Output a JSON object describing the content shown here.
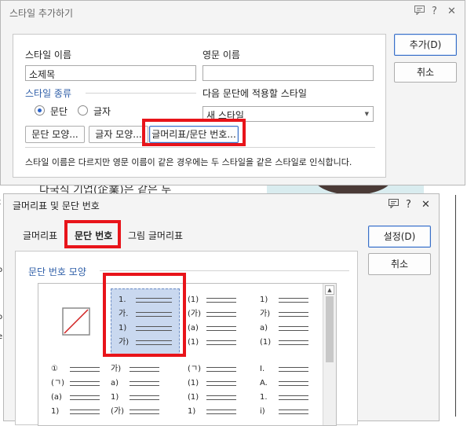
{
  "dialog1": {
    "title": "스타일 추가하기",
    "style_name_label": "스타일 이름",
    "style_name_value": "소제목",
    "english_name_label": "영문 이름",
    "english_name_value": "",
    "style_kind_label": "스타일 종류",
    "radio_paragraph": "문단",
    "radio_char": "글자",
    "next_style_label": "다음 문단에 적용할 스타일",
    "next_style_value": "새 스타일",
    "btn_para_shape": "문단 모양...",
    "btn_char_shape": "글자 모양...",
    "btn_bullet": "글머리표/문단 번호...",
    "note": "스타일 이름은 다르지만 영문 이름이 같은 경우에는 두 스타일을 같은 스타일로 인식합니다.",
    "add_button": "추가(D)",
    "cancel_button": "취소"
  },
  "background_text": {
    "line1": "다국식 기업(企業)은 같은 두",
    "left_chars": [
      "t",
      "o",
      "o",
      "e"
    ]
  },
  "dialog2": {
    "title": "글머리표 및 문단 번호",
    "tabs": [
      "글머리표",
      "문단 번호",
      "그림 글머리표"
    ],
    "active_tab_index": 1,
    "section_label": "문단 번호 모양",
    "set_button": "설정(D)",
    "cancel_button": "취소",
    "gallery": [
      {
        "type": "none"
      },
      {
        "type": "list",
        "prefixes": [
          "1.",
          "가.",
          "1)",
          "가)"
        ],
        "selected": true
      },
      {
        "type": "list",
        "prefixes": [
          "(1)",
          "(가)",
          "(a)",
          "(1)"
        ]
      },
      {
        "type": "list",
        "prefixes": [
          "1)",
          "가)",
          "a)",
          "(1)"
        ]
      },
      {
        "type": "list",
        "prefixes": [
          "①",
          "(ㄱ)",
          "(a)",
          "1)"
        ]
      },
      {
        "type": "list",
        "prefixes": [
          "가)",
          "a)",
          "1)",
          "(가)"
        ]
      },
      {
        "type": "list",
        "prefixes": [
          "(ㄱ)",
          "(1)",
          "(1)",
          "1)"
        ]
      },
      {
        "type": "list",
        "prefixes": [
          "I.",
          "A.",
          "1.",
          "i)"
        ]
      }
    ]
  },
  "colors": {
    "highlight_red": "#e8141a",
    "accent_blue": "#2f5fa8",
    "selection_fill": "#c9d8ef"
  }
}
